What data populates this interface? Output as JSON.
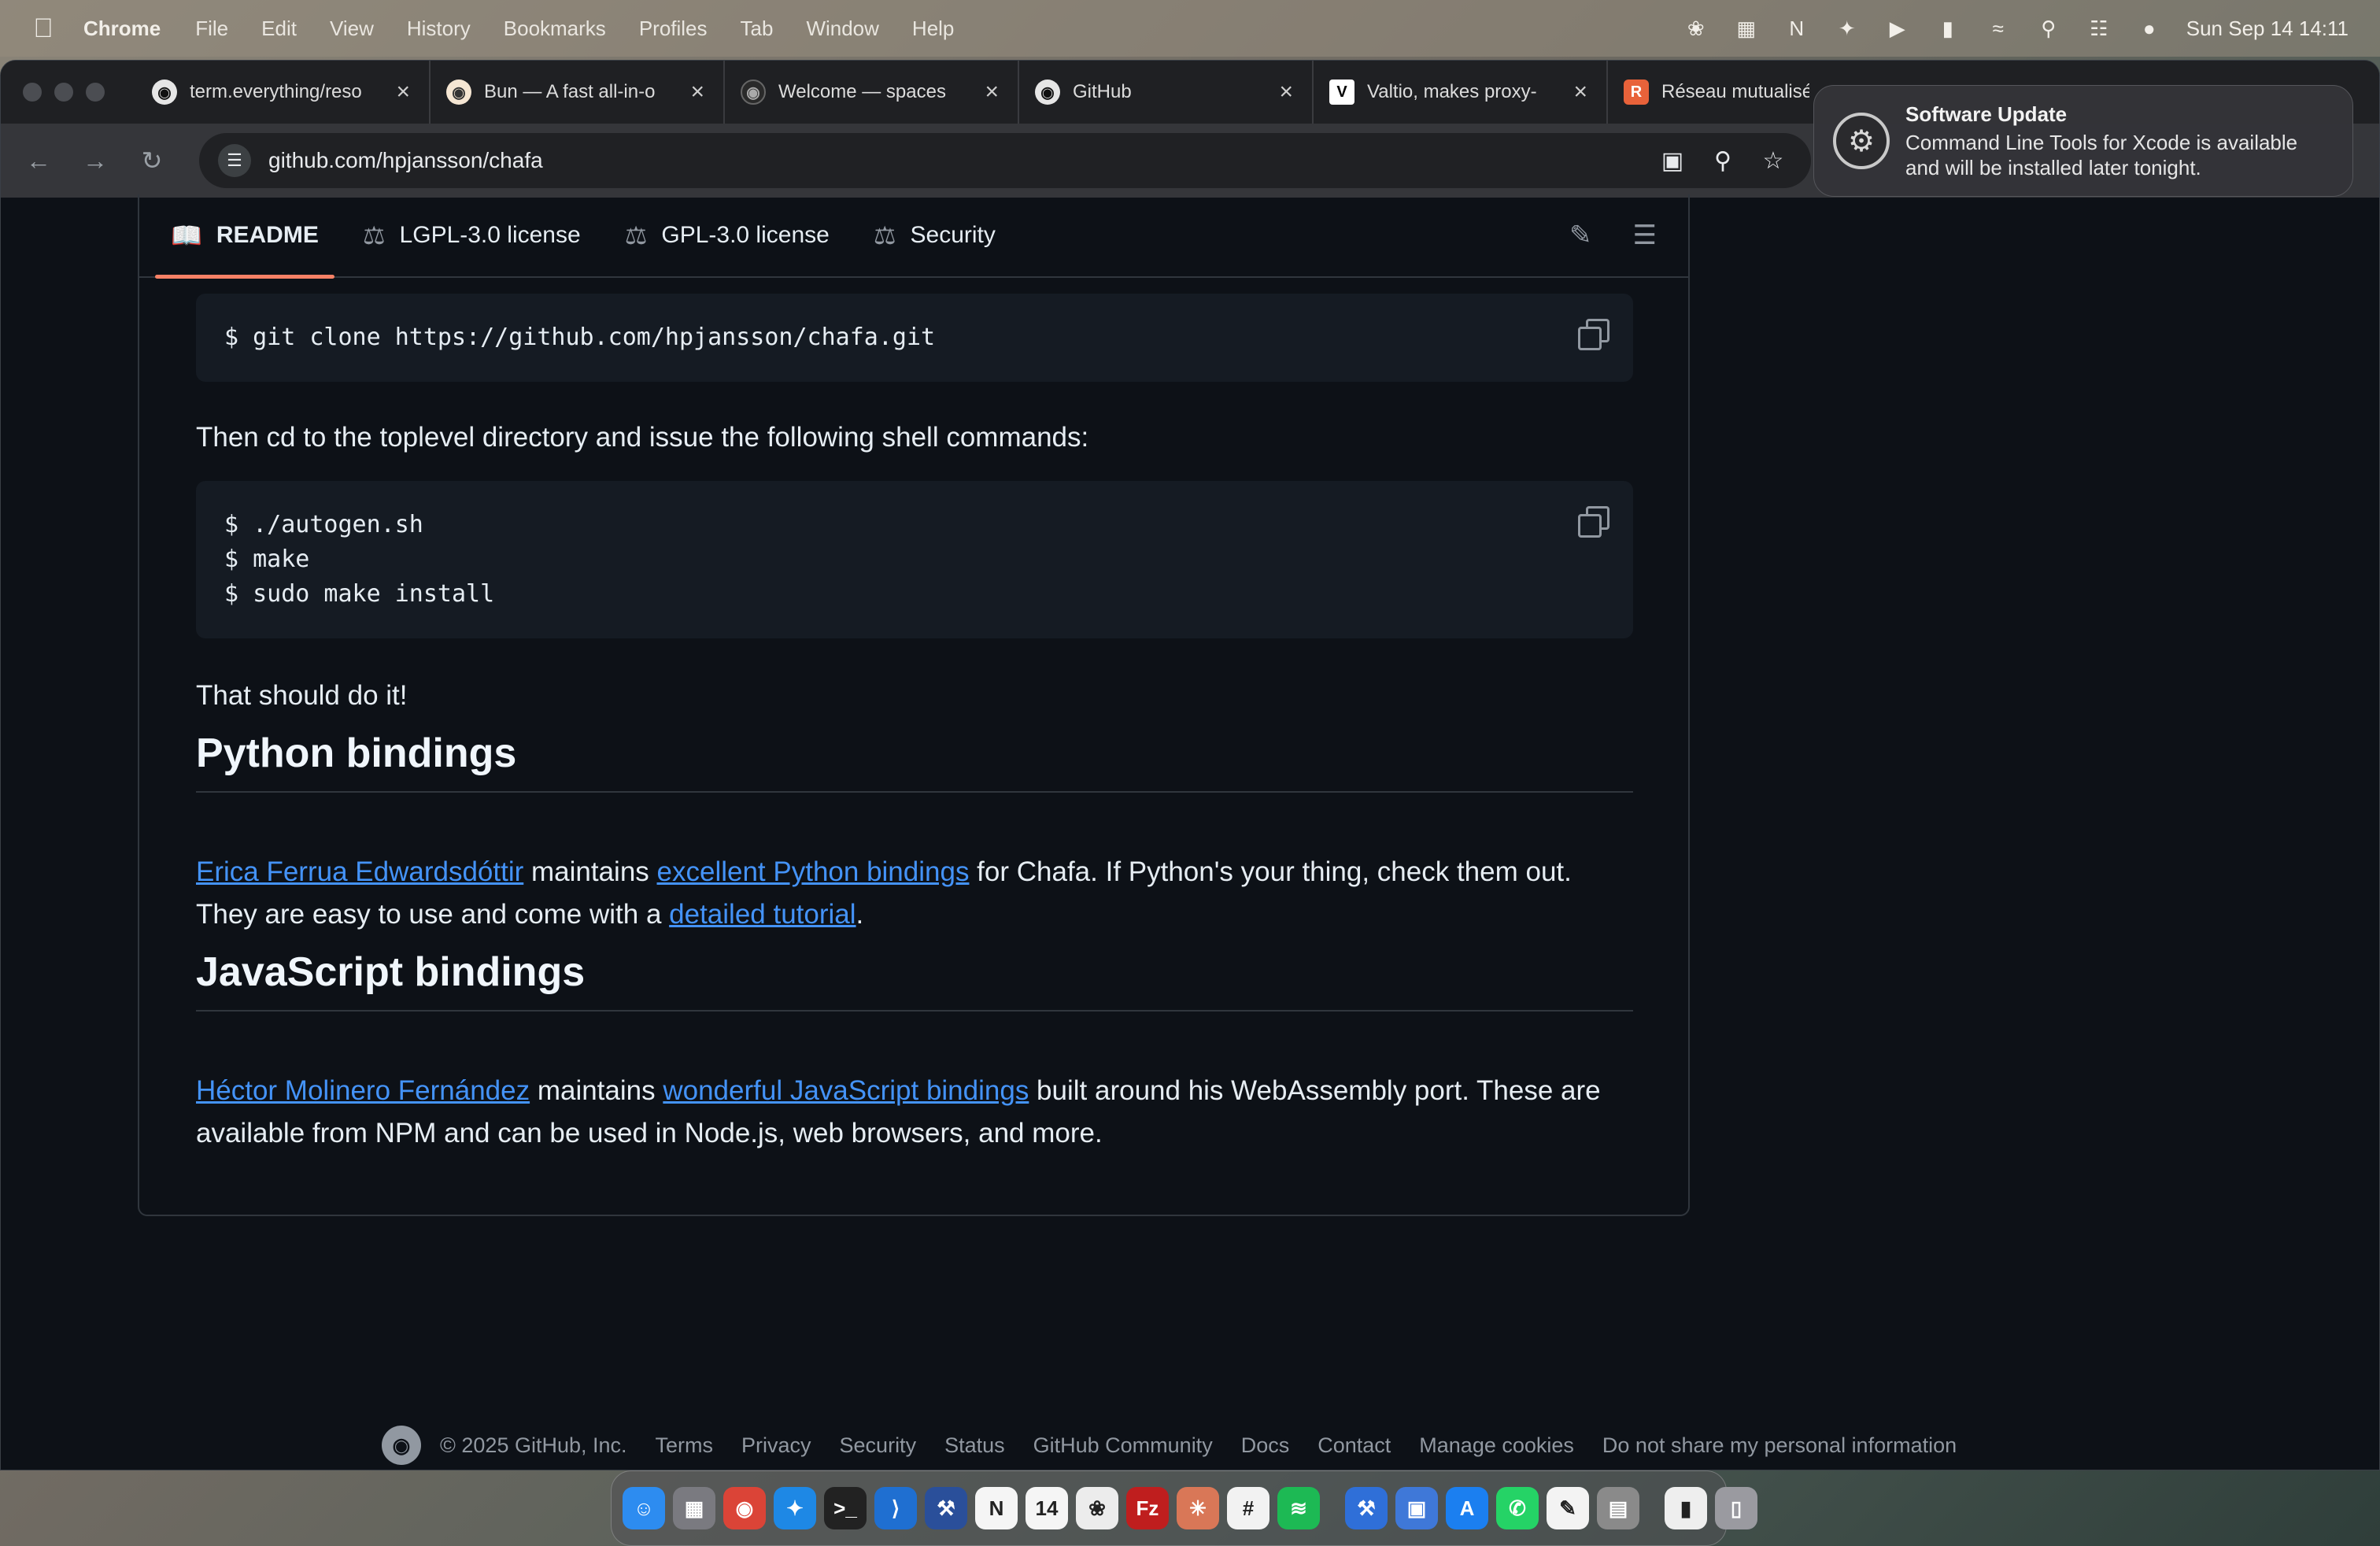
{
  "menubar": {
    "app_name": "Chrome",
    "menus": [
      "File",
      "Edit",
      "View",
      "History",
      "Bookmarks",
      "Profiles",
      "Tab",
      "Window",
      "Help"
    ],
    "status_icons": [
      "openai-icon",
      "calendar-icon",
      "notion-icon",
      "cursor-icon",
      "play-icon",
      "battery-icon",
      "wifi-icon",
      "search-icon",
      "control-center-icon",
      "siri-icon"
    ],
    "clock": "Sun Sep 14  14:11"
  },
  "tabs": [
    {
      "title": "term.everything/reso",
      "icon": "github-icon"
    },
    {
      "title": "Bun — A fast all-in-o",
      "icon": "bun-icon"
    },
    {
      "title": "Welcome — spaces",
      "icon": "spaces-icon"
    },
    {
      "title": "GitHub",
      "icon": "github-icon"
    },
    {
      "title": "Valtio, makes proxy-",
      "icon": "valtio-icon"
    },
    {
      "title": "Réseau mutualisé",
      "icon": "reseau-icon"
    }
  ],
  "toolbar": {
    "url": "github.com/hpjansson/chafa"
  },
  "readme_tabs": [
    {
      "label": "README",
      "icon": "book-icon"
    },
    {
      "label": "LGPL-3.0 license",
      "icon": "scale-icon"
    },
    {
      "label": "GPL-3.0 license",
      "icon": "scale-icon"
    },
    {
      "label": "Security",
      "icon": "scale-icon"
    }
  ],
  "content": {
    "code1": "$ git clone https://github.com/hpjansson/chafa.git",
    "para1": "Then cd to the toplevel directory and issue the following shell commands:",
    "code2": [
      "$ ./autogen.sh",
      "$ make",
      "$ sudo make install"
    ],
    "para2": "That should do it!",
    "h_python": "Python bindings",
    "python_link1": "Erica Ferrua Edwardsdóttir",
    "python_t1": " maintains ",
    "python_link2": "excellent Python bindings",
    "python_t2": " for Chafa. If Python's your thing, check them out. They are easy to use and come with a ",
    "python_link3": "detailed tutorial",
    "python_t3": ".",
    "h_js": "JavaScript bindings",
    "js_link1": "Héctor Molinero Fernández",
    "js_t1": " maintains ",
    "js_link2": "wonderful JavaScript bindings",
    "js_t2": " built around his WebAssembly port. These are available from NPM and can be used in Node.js, web browsers, and more."
  },
  "footer": {
    "copyright": "© 2025 GitHub, Inc.",
    "links": [
      "Terms",
      "Privacy",
      "Security",
      "Status",
      "GitHub Community",
      "Docs",
      "Contact",
      "Manage cookies",
      "Do not share my personal information"
    ]
  },
  "notification": {
    "title": "Software Update",
    "body": "Command Line Tools for Xcode is available and will be installed later tonight."
  },
  "dock": {
    "apps": [
      {
        "name": "finder-icon",
        "color": "#2d8cf0"
      },
      {
        "name": "launchpad-icon",
        "color": "#7a7a80"
      },
      {
        "name": "chrome-icon",
        "color": "#db4437"
      },
      {
        "name": "safari-icon",
        "color": "#1e88e5"
      },
      {
        "name": "terminal-icon",
        "color": "#222222"
      },
      {
        "name": "vscode-icon",
        "color": "#1f6fd1"
      },
      {
        "name": "xcode-icon",
        "color": "#2a4f9a"
      },
      {
        "name": "notion-icon",
        "color": "#f5f5f5"
      },
      {
        "name": "calendar-icon",
        "color": "#f5f5f5"
      },
      {
        "name": "chatgpt-icon",
        "color": "#ececec"
      },
      {
        "name": "filezilla-icon",
        "color": "#bf1e1e"
      },
      {
        "name": "claude-icon",
        "color": "#d97757"
      },
      {
        "name": "slack-icon",
        "color": "#f2f2f2"
      },
      {
        "name": "spotify-icon",
        "color": "#1db954"
      },
      {
        "name": "xcode-dev-icon",
        "color": "#2f6fd8"
      },
      {
        "name": "simulator-icon",
        "color": "#3f78d8"
      },
      {
        "name": "appstore-icon",
        "color": "#1b7ff0"
      },
      {
        "name": "whatsapp-icon",
        "color": "#25d366"
      },
      {
        "name": "textedit-icon",
        "color": "#f3f3f3"
      },
      {
        "name": "calculator-icon",
        "color": "#8a8a8a"
      },
      {
        "name": "downloads-icon",
        "color": "#eeeeee"
      },
      {
        "name": "trash-icon",
        "color": "#9a9aa0"
      }
    ]
  }
}
